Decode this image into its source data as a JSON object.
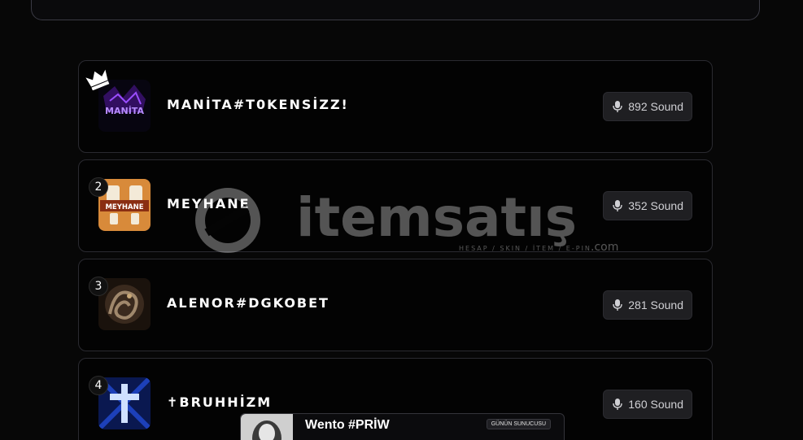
{
  "leaderboard": {
    "entries": [
      {
        "rank": "1",
        "name": "MANİTA#T0KENSİZZ!",
        "sound_count": "892 Sound",
        "avatar_text": "MANİTA"
      },
      {
        "rank": "2",
        "name": "MEYHANE",
        "sound_count": "352 Sound",
        "avatar_text": "MEYHANE"
      },
      {
        "rank": "3",
        "name": "ALENOR#DGKOBET",
        "sound_count": "281 Sound"
      },
      {
        "rank": "4",
        "name": "✝BRUHHİZM",
        "sound_count": "160 Sound"
      }
    ]
  },
  "watermark": {
    "brand": "itemsatış",
    "tagline": "HESAP / SKIN / İTEM / E-PIN",
    "suffix": ".com"
  },
  "host": {
    "name": "Wento #PRİW",
    "tag": "GÜNÜN SUNUCUSU"
  },
  "colors": {
    "background": "#070707",
    "card_border": "#2a2a30",
    "pill_bg": "#1f1f22",
    "avatar_purple": "#7a2cff",
    "avatar_orange": "#d88a3a",
    "avatar_blue": "#2a5cff"
  },
  "icons": {
    "crown": "crown-icon",
    "mic": "microphone-icon"
  }
}
